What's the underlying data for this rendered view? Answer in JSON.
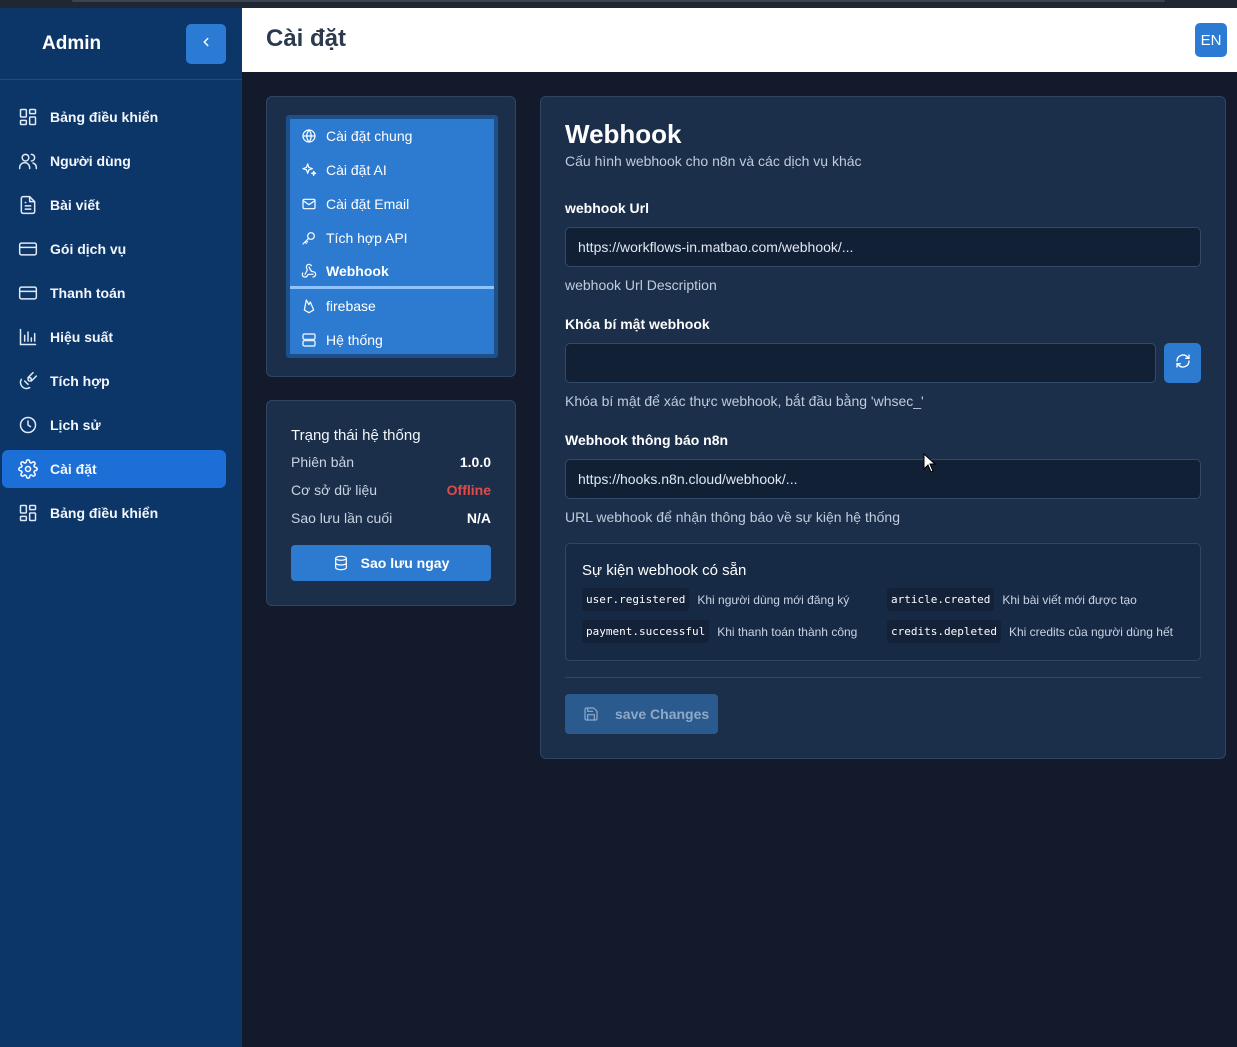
{
  "sidebar": {
    "brand": "Admin",
    "items": [
      {
        "label": "Bảng điều khiển",
        "icon": "dashboard-icon"
      },
      {
        "label": "Người dùng",
        "icon": "users-icon"
      },
      {
        "label": "Bài viết",
        "icon": "file-text-icon"
      },
      {
        "label": "Gói dịch vụ",
        "icon": "credit-card-icon"
      },
      {
        "label": "Thanh toán",
        "icon": "credit-card-icon"
      },
      {
        "label": "Hiệu suất",
        "icon": "bar-chart-icon"
      },
      {
        "label": "Tích hợp",
        "icon": "satellite-icon"
      },
      {
        "label": "Lịch sử",
        "icon": "clock-icon"
      },
      {
        "label": "Cài đặt",
        "icon": "gear-icon",
        "active": true
      },
      {
        "label": "Bảng điều khiển",
        "icon": "dashboard-icon"
      }
    ]
  },
  "header": {
    "title": "Cài đặt",
    "lang": "EN"
  },
  "settings_menu": {
    "items": [
      {
        "label": "Cài đặt chung",
        "icon": "globe-icon"
      },
      {
        "label": "Cài đặt AI",
        "icon": "sparkles-icon"
      },
      {
        "label": "Cài đặt Email",
        "icon": "mail-icon"
      },
      {
        "label": "Tích hợp API",
        "icon": "key-icon"
      },
      {
        "label": "Webhook",
        "icon": "webhook-icon",
        "active": true
      },
      {
        "label": "firebase",
        "icon": "flame-icon"
      },
      {
        "label": "Hệ thống",
        "icon": "server-icon"
      }
    ]
  },
  "status": {
    "title": "Trạng thái hệ thống",
    "version_label": "Phiên bản",
    "version_value": "1.0.0",
    "db_label": "Cơ sở dữ liệu",
    "db_value": "Offline",
    "backup_label": "Sao lưu lần cuối",
    "backup_value": "N/A",
    "backup_button": "Sao lưu ngay"
  },
  "webhook": {
    "title": "Webhook",
    "subtitle": "Cấu hình webhook cho n8n và các dịch vụ khác",
    "url_label": "webhook Url",
    "url_value": "https://workflows-in.matbao.com/webhook/...",
    "url_desc": "webhook Url Description",
    "secret_label": "Khóa bí mật webhook",
    "secret_value": "",
    "secret_desc": "Khóa bí mật để xác thực webhook, bắt đầu bằng 'whsec_'",
    "n8n_label": "Webhook thông báo n8n",
    "n8n_value": "https://hooks.n8n.cloud/webhook/...",
    "n8n_desc": "URL webhook để nhận thông báo về sự kiện hệ thống",
    "events_title": "Sự kiện webhook có sẵn",
    "events": [
      {
        "code": "user.registered",
        "desc": "Khi người dùng mới đăng ký"
      },
      {
        "code": "article.created",
        "desc": "Khi bài viết mới được tạo"
      },
      {
        "code": "payment.successful",
        "desc": "Khi thanh toán thành công"
      },
      {
        "code": "credits.depleted",
        "desc": "Khi credits của người dùng hết"
      }
    ],
    "save_button": "save Changes"
  },
  "colors": {
    "sidebar_bg": "#0c3568",
    "accent": "#2d7bd0",
    "offline": "#e34a4a",
    "page_bg": "#131a2b"
  }
}
